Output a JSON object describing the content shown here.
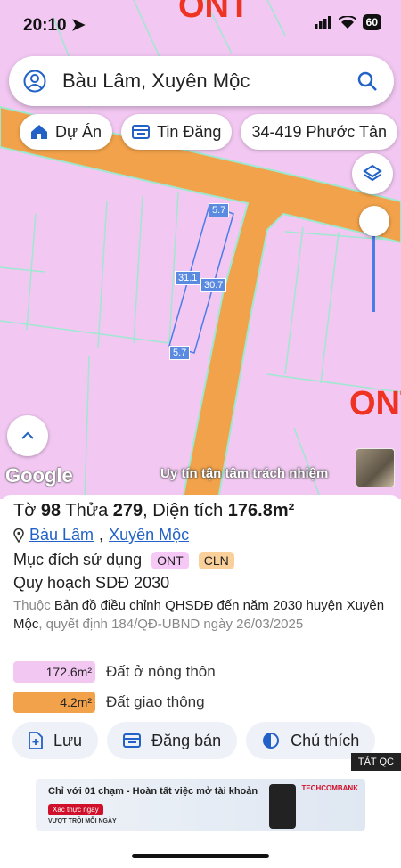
{
  "status": {
    "time": "20:10",
    "battery": "60"
  },
  "search": {
    "text": "Bàu Lâm, Xuyên Mộc"
  },
  "chips": [
    {
      "label": "Dự Án",
      "icon": "house-icon"
    },
    {
      "label": "Tin Đăng",
      "icon": "listing-icon"
    },
    {
      "label": "34-419 Phước Tân",
      "icon": ""
    }
  ],
  "map": {
    "zone_labels": [
      "ONT",
      "ONT"
    ],
    "measurements": [
      "5.7",
      "31.1",
      "30.7",
      "5.7"
    ],
    "google_label": "Google",
    "watermark": "Uy tín tận tâm trách nhiệm",
    "colors": {
      "land": "#f2c8f2",
      "road": "#f2a24a",
      "road_edge": "#9ee8d0",
      "parcel": "#4a7de8"
    }
  },
  "sheet": {
    "title_prefix": "Tờ",
    "sheet_no": "98",
    "parcel_label": "Thửa",
    "parcel_no": "279",
    "area_label": "Diện tích",
    "area": "176.8m²",
    "loc1": "Bàu Lâm",
    "loc_sep": ",",
    "loc2": "Xuyên Mộc",
    "purpose_label": "Mục đích sử dụng",
    "tag1": "ONT",
    "tag2": "CLN",
    "plan_label": "Quy hoạch SDĐ 2030",
    "desc_prefix": "Thuộc",
    "desc_main": "Bản đồ điều chỉnh QHSDĐ đến năm 2030 huyện Xuyên Mộc",
    "desc_suffix": ", quyết định 184/QĐ-UBND ngày 26/03/2025",
    "bars": [
      {
        "value": "172.6m²",
        "label": "Đất ở nông thôn",
        "color": "#f2c8f2",
        "fraction": 0.976
      },
      {
        "value": "4.2m²",
        "label": "Đất giao thông",
        "color": "#f2a24a",
        "fraction": 0.024
      }
    ],
    "actions": [
      {
        "label": "Lưu",
        "icon": "save-plus-icon"
      },
      {
        "label": "Đăng bán",
        "icon": "listing-icon"
      },
      {
        "label": "Chú thích",
        "icon": "half-circle-icon"
      }
    ]
  },
  "ad": {
    "close_label": "TẮT QC",
    "headline": "Chỉ với 01 chạm - Hoàn tất việc mở tài khoản",
    "cta": "Xác thực ngay",
    "sub": "VƯỢT TRỘI MỖI NGÀY",
    "brand": "TECHCOMBANK"
  }
}
